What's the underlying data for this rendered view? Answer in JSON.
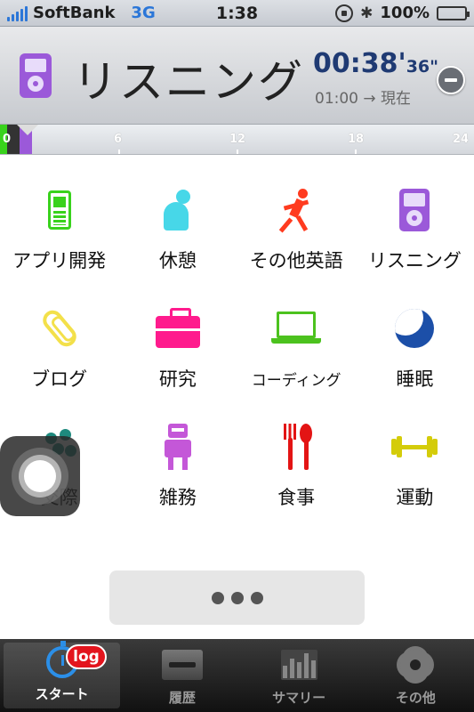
{
  "status_bar": {
    "carrier": "SoftBank",
    "network": "3G",
    "time": "1:38",
    "battery": "100%"
  },
  "header": {
    "title": "リスニング",
    "icon": "ipod-icon",
    "elapsed_main": "00:38'",
    "elapsed_sec": "36\"",
    "start_time": "01:00 → 現在"
  },
  "timeline": {
    "ticks": [
      "0",
      "6",
      "12",
      "18",
      "24"
    ]
  },
  "activities": [
    {
      "label": "アプリ開発",
      "icon": "phone-icon",
      "color": "#39d21c"
    },
    {
      "label": "休憩",
      "icon": "resting-person-icon",
      "color": "#47d7e8"
    },
    {
      "label": "その他英語",
      "icon": "runner-icon",
      "color": "#ff3b1f"
    },
    {
      "label": "リスニング",
      "icon": "ipod-icon",
      "color": "#9b59d9"
    },
    {
      "label": "ブログ",
      "icon": "paperclip-icon",
      "color": "#f3e04a"
    },
    {
      "label": "研究",
      "icon": "briefcase-icon",
      "color": "#ff1b8d"
    },
    {
      "label": "コーディング",
      "icon": "laptop-icon",
      "color": "#4cc21e"
    },
    {
      "label": "睡眠",
      "icon": "moon-icon",
      "color": "#1c4fa8"
    },
    {
      "label": "交際",
      "icon": "people-icon",
      "color": "#1e8a7e"
    },
    {
      "label": "雑務",
      "icon": "robot-icon",
      "color": "#c457d8"
    },
    {
      "label": "食事",
      "icon": "cutlery-icon",
      "color": "#e31414"
    },
    {
      "label": "運動",
      "icon": "dumbbell-icon",
      "color": "#d4cc0a"
    }
  ],
  "more_button": {
    "icon": "ellipsis-icon"
  },
  "tabbar": {
    "tabs": [
      {
        "label": "スタート",
        "icon": "stopwatch-icon",
        "badge": "log"
      },
      {
        "label": "履歴",
        "icon": "tray-icon"
      },
      {
        "label": "サマリー",
        "icon": "bar-chart-icon"
      },
      {
        "label": "その他",
        "icon": "gear-icon"
      }
    ]
  }
}
